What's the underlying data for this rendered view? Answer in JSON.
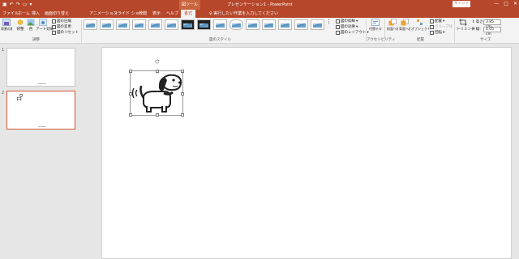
{
  "title_bar": {
    "document_title": "プレゼンテーション1 - PowerPoint",
    "context_tab_group": "図ツール",
    "signin_label": "サインイン",
    "window_buttons": [
      "—",
      "□",
      "✕"
    ]
  },
  "tabs": [
    {
      "label": "ファイル"
    },
    {
      "label": "ホーム"
    },
    {
      "label": "挿入"
    },
    {
      "label": "画面切り替え"
    },
    {
      "label": "アニメーション"
    },
    {
      "label": "スライド ショー"
    },
    {
      "label": "校閲"
    },
    {
      "label": "表示"
    },
    {
      "label": "ヘルプ"
    },
    {
      "label": "書式"
    }
  ],
  "tell_me": "実行したい作業を入力してください",
  "ribbon": {
    "adjust": {
      "group_label": "調整",
      "remove_bg": "背景の削除",
      "corrections": "修整",
      "color": "色",
      "artistic": "アート効果",
      "compress": "図の圧縮",
      "change": "図の変更",
      "reset": "図のリセット"
    },
    "styles": {
      "group_label": "図のスタイル",
      "border": "図の枠線",
      "effects": "図の効果",
      "layout": "図のレイアウト"
    },
    "accessibility": {
      "group_label": "アクセシビリティ",
      "alt_text": "代替テキスト"
    },
    "arrange": {
      "group_label": "配置",
      "bring_forward": "前面へ移動",
      "send_backward": "背面へ移動",
      "selection_pane": "オブジェクトの選択と表示",
      "align": "配置",
      "group": "グループ化",
      "rotate": "回転"
    },
    "size": {
      "group_label": "サイズ",
      "crop": "トリミング",
      "height_label": "高さ:",
      "height_value": "3.85 cm",
      "width_label": "幅:",
      "width_value": "4.05 cm"
    }
  },
  "slides": [
    {
      "number": "1"
    },
    {
      "number": "2"
    }
  ],
  "colors": {
    "accent": "#b7472a",
    "selection": "#d0552f"
  }
}
